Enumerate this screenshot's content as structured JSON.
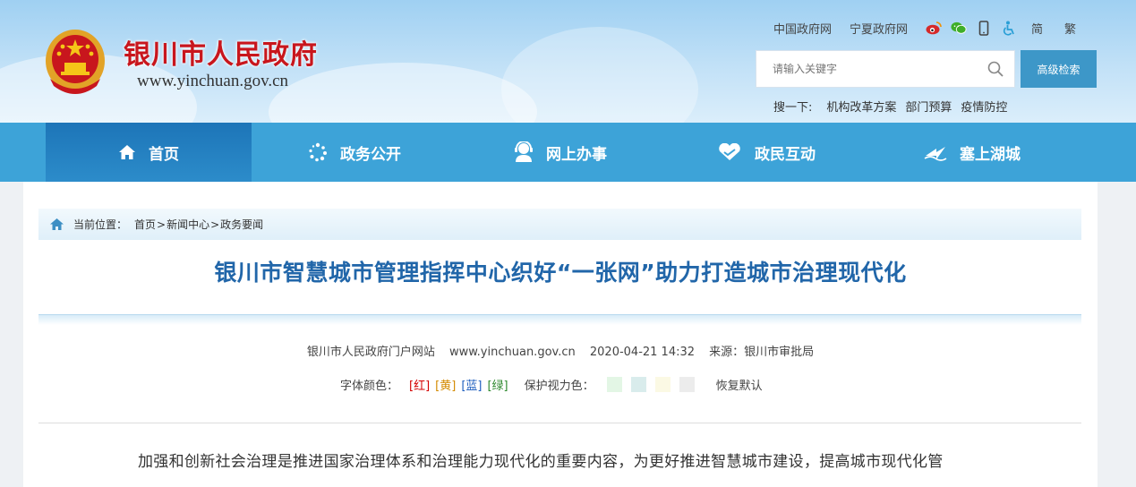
{
  "header": {
    "site_title": "银川市人民政府",
    "site_url": "www.yinchuan.gov.cn",
    "top_links": [
      "中国政府网",
      "宁夏政府网"
    ],
    "lang_simplified": "简",
    "lang_traditional": "繁",
    "search_placeholder": "请输入关键字",
    "advanced_search_label": "高级检索",
    "hot_label": "搜一下:",
    "hot_terms": [
      "机构改革方案",
      "部门预算",
      "疫情防控"
    ]
  },
  "nav": {
    "items": [
      "首页",
      "政务公开",
      "网上办事",
      "政民互动",
      "塞上湖城"
    ]
  },
  "breadcrumb": {
    "label": "当前位置：",
    "path": [
      "首页",
      "新闻中心",
      "政务要闻"
    ],
    "separator": ">"
  },
  "article": {
    "title": "银川市智慧城市管理指挥中心织好“一张网”助力打造城市治理现代化",
    "meta": {
      "publisher": "银川市人民政府门户网站",
      "url": "www.yinchuan.gov.cn",
      "datetime": "2020-04-21 14:32",
      "source": "来源：银川市审批局"
    },
    "tools": {
      "font_color_label": "字体颜色：",
      "colors": [
        {
          "label": "[红]",
          "color": "#d40000"
        },
        {
          "label": "[黄]",
          "color": "#d48a00"
        },
        {
          "label": "[蓝]",
          "color": "#1f5fbf"
        },
        {
          "label": "[绿]",
          "color": "#2f8a2f"
        }
      ],
      "eye_label": "保护视力色：",
      "swatches": [
        "#e3f6e5",
        "#d9ecec",
        "#fbf9e4",
        "#ececec"
      ],
      "reset_label": "恢复默认"
    },
    "paragraph_1": "加强和创新社会治理是推进国家治理体系和治理能力现代化的重要内容，为更好推进智慧城市建设，提高城市现代化管"
  },
  "colors": {
    "nav_bg": "#3da3d8",
    "nav_active": "#1d75b8",
    "title_red": "#c8161d",
    "article_title": "#2166a9"
  },
  "icons": [
    "emblem",
    "weibo-icon",
    "wechat-icon",
    "mobile-icon",
    "accessibility-icon",
    "search-icon",
    "home-icon",
    "open-gov-icon",
    "service-icon",
    "interaction-icon",
    "city-icon"
  ]
}
